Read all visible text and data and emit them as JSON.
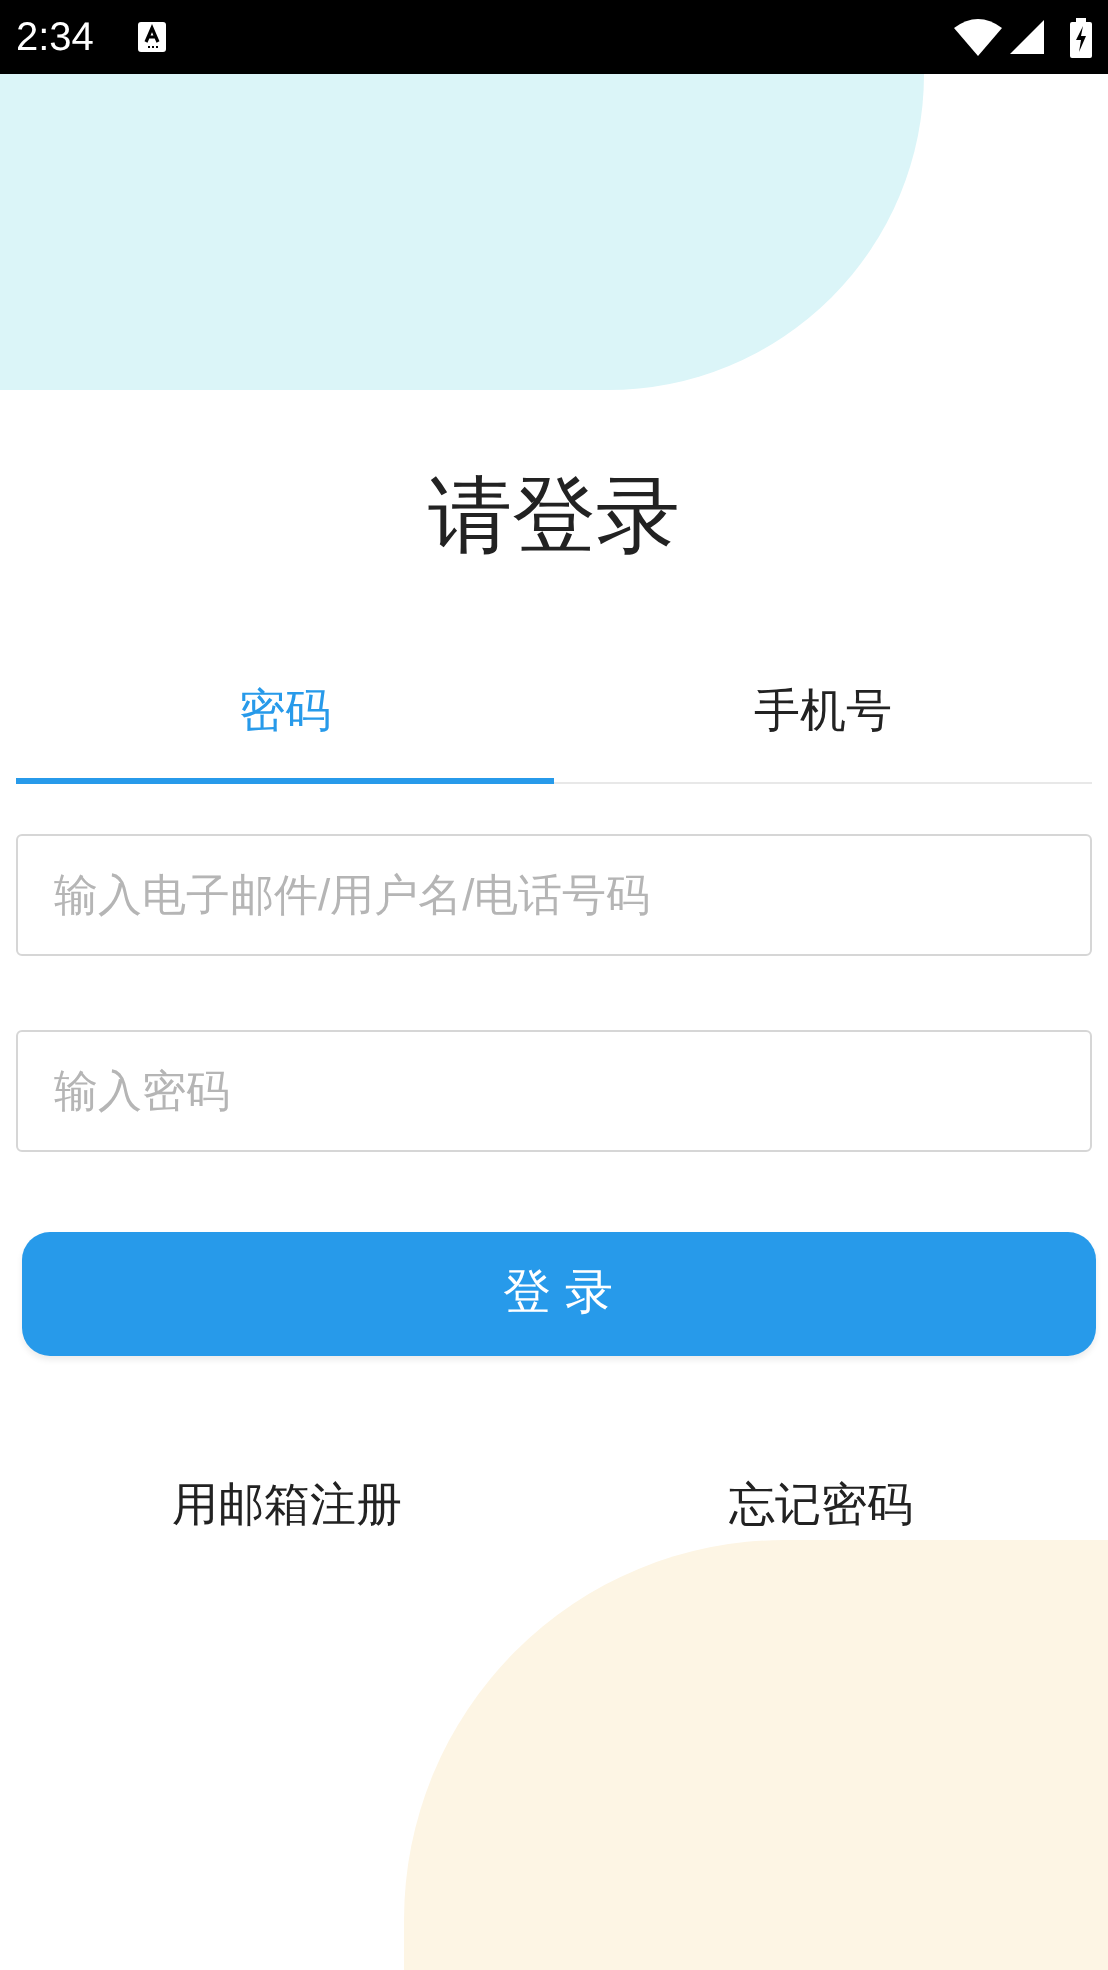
{
  "status_bar": {
    "time": "2:34"
  },
  "title": "请登录",
  "tabs": [
    {
      "label": "密码",
      "selected": true
    },
    {
      "label": "手机号",
      "selected": false
    }
  ],
  "fields": [
    {
      "placeholder": "输入电子邮件/用户名/电话号码"
    },
    {
      "placeholder": "输入密码"
    }
  ],
  "login_button": "登 录",
  "links": [
    "用邮箱注册",
    "忘记密码"
  ]
}
